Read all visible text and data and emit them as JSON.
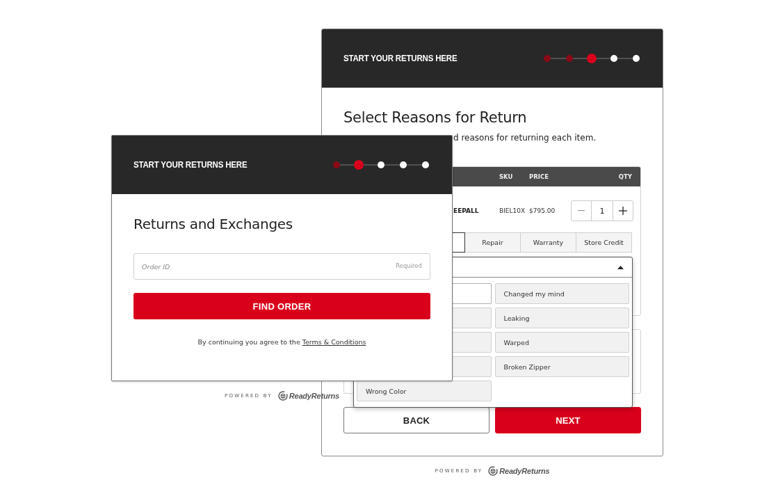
{
  "back_window": {
    "header": {
      "title": "START YOUR RETURNS HERE",
      "steps": [
        {
          "completed": true,
          "current": false
        },
        {
          "completed": true,
          "current": false
        },
        {
          "completed": false,
          "current": true
        },
        {
          "completed": false,
          "current": false
        },
        {
          "completed": false,
          "current": false
        }
      ]
    },
    "title": "Select Reasons for Return",
    "subtitle": "d reasons for returning each item.",
    "table": {
      "columns": [
        "SKU",
        "PRICE",
        "QTY"
      ],
      "rows": [
        {
          "name": "EEPALL",
          "sku": "BIEL10X",
          "price": "$795.00",
          "qty": "1"
        }
      ]
    },
    "tabs": [
      {
        "selected": true
      },
      {
        "label": "Repair",
        "selected": false
      },
      {
        "label": "Warranty",
        "selected": false
      },
      {
        "label": "Store Credit",
        "selected": false
      }
    ],
    "dropdown": {
      "expanded": true,
      "options": [
        {
          "selected": true
        },
        {
          "label": "Changed my mind",
          "selected": false
        },
        {
          "selected": false
        },
        {
          "label": "Leaking",
          "selected": false
        },
        {
          "selected": false
        },
        {
          "label": "Warped",
          "selected": false
        },
        {
          "selected": false
        },
        {
          "label": "Broken Zipper",
          "selected": false
        },
        {
          "label": "Wrong Color",
          "selected": false
        }
      ]
    },
    "buttons": [
      {
        "label": "BACK",
        "kind": "secondary"
      },
      {
        "label": "NEXT",
        "kind": "primary"
      }
    ],
    "footer": {
      "prefix": "POWERED BY",
      "brand": "ReadyReturns"
    }
  },
  "front_window": {
    "header": {
      "title": "START YOUR RETURNS HERE",
      "steps": [
        {
          "completed": true,
          "current": false
        },
        {
          "completed": false,
          "current": true
        },
        {
          "completed": false,
          "current": false
        },
        {
          "completed": false,
          "current": false
        },
        {
          "completed": false,
          "current": false
        }
      ]
    },
    "title": "Returns and Exchanges",
    "order_field": {
      "placeholder": "Order ID",
      "hint": "Required"
    },
    "button": "FIND ORDER",
    "terms": {
      "text": "By continuing you agree to the ",
      "link": "Terms & Conditions"
    },
    "footer": {
      "prefix": "POWERED BY",
      "brand": "ReadyReturns"
    }
  }
}
